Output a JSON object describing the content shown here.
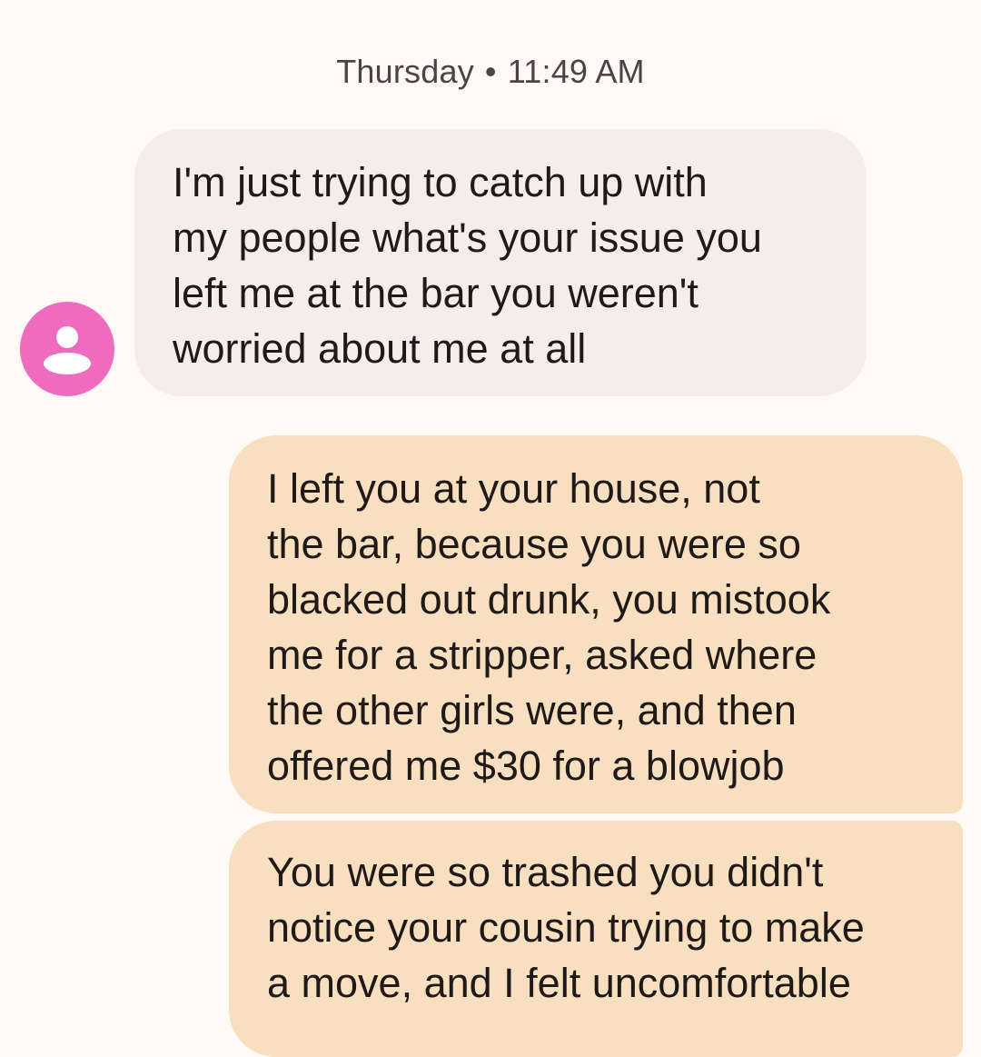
{
  "conversation": {
    "timestamp": {
      "day": "Thursday",
      "separator": "•",
      "time": "11:49 AM"
    },
    "contact_avatar": {
      "icon": "person-icon",
      "color": "#ef6bbf"
    },
    "messages": [
      {
        "direction": "incoming",
        "lines": [
          "I'm just trying to catch up with",
          "my people what's your issue you",
          "left me at the bar you weren't",
          "worried about me at all"
        ]
      },
      {
        "direction": "outgoing",
        "lines": [
          "I left you at your house, not",
          "the bar, because you were so",
          "blacked out drunk, you mistook",
          "me for a stripper, asked where",
          "the other girls were, and then",
          "offered me $30 for a blowjob"
        ]
      },
      {
        "direction": "outgoing",
        "lines": [
          "You were so trashed you didn't",
          "notice your cousin trying to make",
          "a move, and I felt uncomfortable"
        ]
      }
    ]
  },
  "colors": {
    "background": "#fffaf6",
    "incoming_bubble": "#f6ede8",
    "outgoing_bubble": "#f7dfc0",
    "text": "#1f1a17",
    "timestamp_text": "#4b4541"
  }
}
